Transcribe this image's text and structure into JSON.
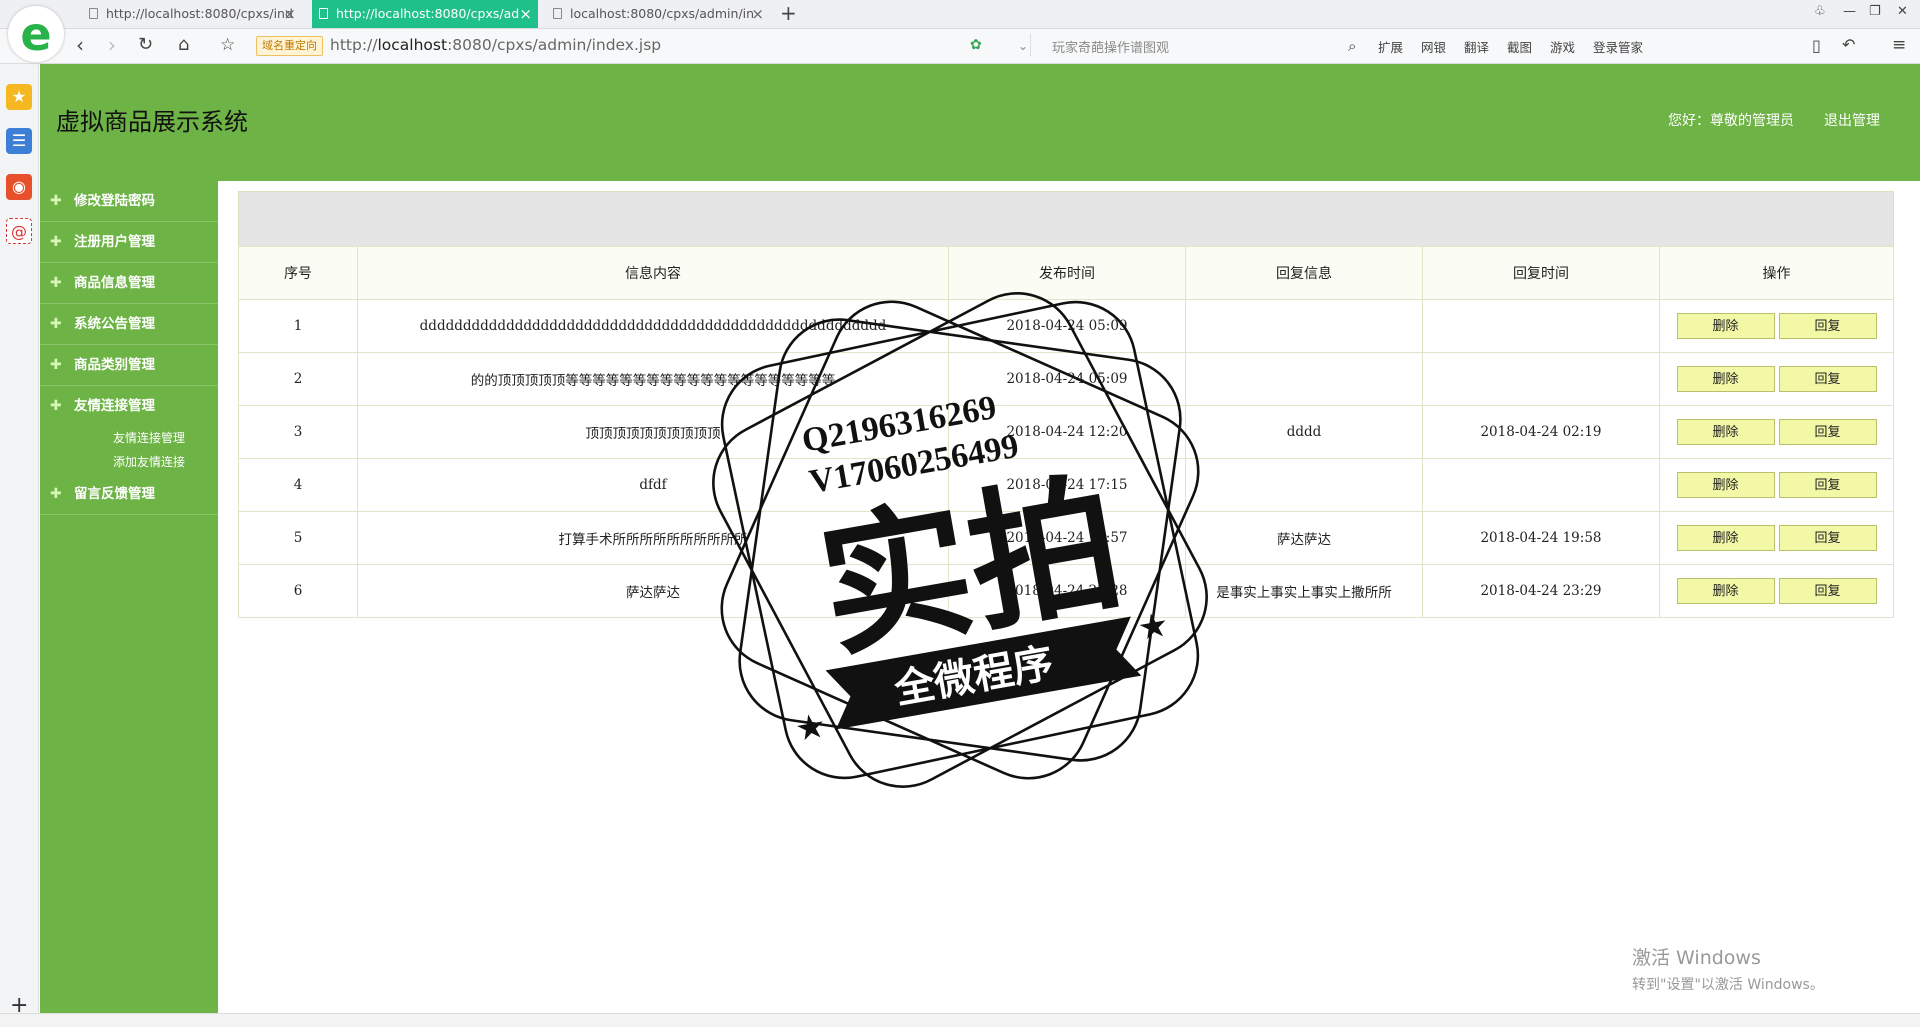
{
  "browser": {
    "logo_letter": "e",
    "tabs": [
      {
        "label": "http://localhost:8080/cpxs/ind",
        "active": false
      },
      {
        "label": "http://localhost:8080/cpxs/ad",
        "active": true
      },
      {
        "label": "localhost:8080/cpxs/admin/in",
        "active": false
      }
    ],
    "new_tab": "+",
    "redirect_badge": "域名重定向",
    "url_prefix": "http://",
    "url_host": "localhost",
    "url_rest": ":8080/cpxs/admin/index.jsp",
    "search_placeholder": "玩家奇葩操作谱图观",
    "tools": [
      "扩展",
      "网银",
      "翻译",
      "截图",
      "游戏",
      "登录管家"
    ]
  },
  "header": {
    "site_title": "虚拟商品展示系统",
    "greeting": "您好：尊敬的管理员",
    "logout": "退出管理"
  },
  "sidebar": {
    "items": [
      {
        "label": "修改登陆密码"
      },
      {
        "label": "注册用户管理"
      },
      {
        "label": "商品信息管理"
      },
      {
        "label": "系统公告管理"
      },
      {
        "label": "商品类别管理"
      },
      {
        "label": "友情连接管理"
      }
    ],
    "sub_items": [
      "友情连接管理",
      "添加友情连接"
    ],
    "last_item": {
      "label": "留言反馈管理"
    }
  },
  "table": {
    "headers": [
      "序号",
      "信息内容",
      "发布时间",
      "回复信息",
      "回复时间",
      "操作"
    ],
    "rows": [
      {
        "id": "1",
        "content": "dddddddddddddddddddddddddddddddddddddddddddddddddddddd",
        "time": "2018-04-24 05:09",
        "reply": "",
        "reply_time": ""
      },
      {
        "id": "2",
        "content": "的的顶顶顶顶顶等等等等等等等等等等等等等等等等等等等等",
        "time": "2018-04-24 05:09",
        "reply": "",
        "reply_time": ""
      },
      {
        "id": "3",
        "content": "顶顶顶顶顶顶顶顶顶顶",
        "time": "2018-04-24 12:20",
        "reply": "dddd",
        "reply_time": "2018-04-24 02:19"
      },
      {
        "id": "4",
        "content": "dfdf",
        "time": "2018-04-24 17:15",
        "reply": "",
        "reply_time": ""
      },
      {
        "id": "5",
        "content": "打算手术所所所所所所所所所所",
        "time": "2018-04-24 19:57",
        "reply": "萨达萨达",
        "reply_time": "2018-04-24 19:58"
      },
      {
        "id": "6",
        "content": "萨达萨达",
        "time": "2018-04-24 23:28",
        "reply": "是事实上事实上事实上撒所所",
        "reply_time": "2018-04-24 23:29"
      }
    ],
    "delete_label": "删除",
    "reply_label": "回复"
  },
  "stamp": {
    "line1": "Q2196316269",
    "line2": "V17060256499",
    "big": "实拍",
    "banner": "全微程序"
  },
  "watermark": {
    "title": "激活 Windows",
    "subtitle": "转到\"设置\"以激活 Windows。"
  }
}
